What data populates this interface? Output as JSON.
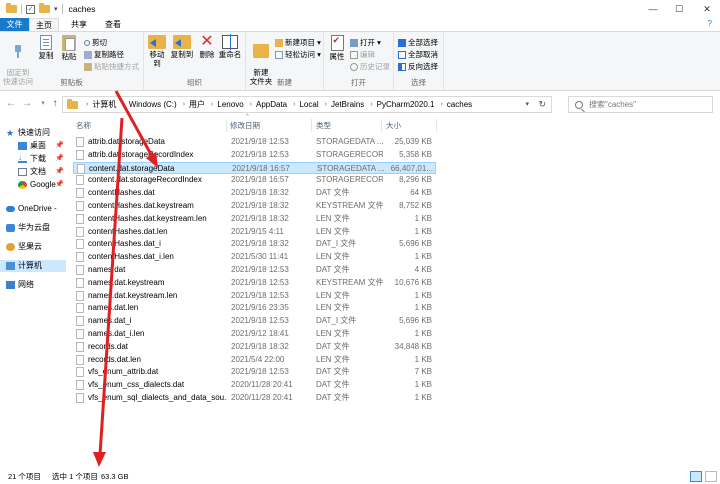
{
  "window": {
    "title": "caches",
    "controls": {
      "minimize": "—",
      "maximize": "☐",
      "close": "✕"
    },
    "help": "?"
  },
  "ribbon_tabs": {
    "file": "文件",
    "home": "主页",
    "share": "共享",
    "view": "查看"
  },
  "ribbon": {
    "clipboard": {
      "label": "剪贴板",
      "pin_quick_access": "固定到\n快速访问",
      "copy": "复制",
      "paste": "粘贴",
      "cut": "剪切",
      "copy_path": "复制路径",
      "paste_shortcut": "粘贴快捷方式"
    },
    "organize": {
      "label": "组织",
      "move_to": "移动到",
      "copy_to": "复制到",
      "delete": "删除",
      "rename": "重命名"
    },
    "new": {
      "label": "新建",
      "new_folder": "新建\n文件夹",
      "new_item": "新建项目 ▾",
      "easy_access": "轻松访问 ▾"
    },
    "open": {
      "label": "打开",
      "properties": "属性",
      "open": "打开 ▾",
      "edit": "编辑",
      "history": "历史记录"
    },
    "select": {
      "label": "选择",
      "select_all": "全部选择",
      "select_none": "全部取消",
      "invert": "反向选择"
    }
  },
  "address": {
    "breadcrumbs": [
      "计算机",
      "Windows (C:)",
      "用户",
      "Lenovo",
      "AppData",
      "Local",
      "JetBrains",
      "PyCharm2020.1",
      "caches"
    ],
    "search_placeholder": "搜索\"caches\""
  },
  "nav": {
    "quick_access": "快速访问",
    "desktop": "桌面",
    "downloads": "下载",
    "documents": "文档",
    "google": "Google",
    "onedrive": "OneDrive -",
    "huawei": "华为云盘",
    "jianguo": "坚果云",
    "computer": "计算机",
    "network": "网络"
  },
  "columns": {
    "name": "名称",
    "date": "修改日期",
    "type": "类型",
    "size": "大小"
  },
  "files": [
    {
      "name": "attrib.dat.storageData",
      "date": "2021/9/18 12:53",
      "type": "STORAGEDATA ...",
      "size": "25,039 KB"
    },
    {
      "name": "attrib.dat.storageRecordIndex",
      "date": "2021/9/18 12:53",
      "type": "STORAGERECOR...",
      "size": "5,358 KB"
    },
    {
      "name": "content.dat.storageData",
      "date": "2021/9/18 16:57",
      "type": "STORAGEDATA ...",
      "size": "66,407,01..."
    },
    {
      "name": "content.dat.storageRecordIndex",
      "date": "2021/9/18 16:57",
      "type": "STORAGERECOR...",
      "size": "8,296 KB"
    },
    {
      "name": "contentHashes.dat",
      "date": "2021/9/18 18:32",
      "type": "DAT 文件",
      "size": "64 KB"
    },
    {
      "name": "contentHashes.dat.keystream",
      "date": "2021/9/18 18:32",
      "type": "KEYSTREAM 文件",
      "size": "8,752 KB"
    },
    {
      "name": "contentHashes.dat.keystream.len",
      "date": "2021/9/18 18:32",
      "type": "LEN 文件",
      "size": "1 KB"
    },
    {
      "name": "contentHashes.dat.len",
      "date": "2021/9/15 4:11",
      "type": "LEN 文件",
      "size": "1 KB"
    },
    {
      "name": "contentHashes.dat_i",
      "date": "2021/9/18 18:32",
      "type": "DAT_I 文件",
      "size": "5,696 KB"
    },
    {
      "name": "contentHashes.dat_i.len",
      "date": "2021/5/30 11:41",
      "type": "LEN 文件",
      "size": "1 KB"
    },
    {
      "name": "names.dat",
      "date": "2021/9/18 12:53",
      "type": "DAT 文件",
      "size": "4 KB"
    },
    {
      "name": "names.dat.keystream",
      "date": "2021/9/18 12:53",
      "type": "KEYSTREAM 文件",
      "size": "10,676 KB"
    },
    {
      "name": "names.dat.keystream.len",
      "date": "2021/9/18 12:53",
      "type": "LEN 文件",
      "size": "1 KB"
    },
    {
      "name": "names.dat.len",
      "date": "2021/9/16 23:35",
      "type": "LEN 文件",
      "size": "1 KB"
    },
    {
      "name": "names.dat_i",
      "date": "2021/9/18 12:53",
      "type": "DAT_I 文件",
      "size": "5,696 KB"
    },
    {
      "name": "names.dat_i.len",
      "date": "2021/9/12 18:41",
      "type": "LEN 文件",
      "size": "1 KB"
    },
    {
      "name": "records.dat",
      "date": "2021/9/18 18:32",
      "type": "DAT 文件",
      "size": "34,848 KB"
    },
    {
      "name": "records.dat.len",
      "date": "2021/5/4 22:00",
      "type": "LEN 文件",
      "size": "1 KB"
    },
    {
      "name": "vfs_enum_attrib.dat",
      "date": "2021/9/18 12:53",
      "type": "DAT 文件",
      "size": "7 KB"
    },
    {
      "name": "vfs_enum_css_dialects.dat",
      "date": "2020/11/28 20:41",
      "type": "DAT 文件",
      "size": "1 KB"
    },
    {
      "name": "vfs_enum_sql_dialects_and_data_sou...",
      "date": "2020/11/28 20:41",
      "type": "DAT 文件",
      "size": "1 KB"
    }
  ],
  "selected_index": 2,
  "status": {
    "count": "21 个项目",
    "selected": "选中 1 个项目",
    "size": "63.3 GB"
  },
  "colors": {
    "accent": "#1979ca",
    "selection": "#cce8ff",
    "annotation": "#e02020"
  }
}
